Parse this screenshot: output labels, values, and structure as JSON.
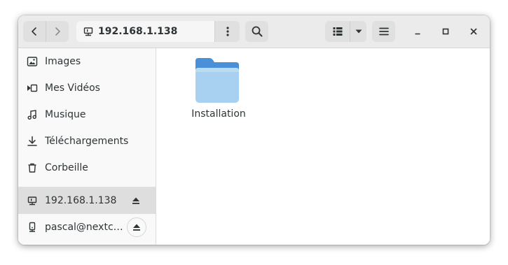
{
  "headerbar": {
    "location": "192.168.1.138"
  },
  "sidebar": {
    "places": [
      {
        "label": "Images",
        "icon": "image-icon"
      },
      {
        "label": "Mes Vidéos",
        "icon": "video-icon"
      },
      {
        "label": "Musique",
        "icon": "music-icon"
      },
      {
        "label": "Téléchargements",
        "icon": "download-icon"
      },
      {
        "label": "Corbeille",
        "icon": "trash-icon"
      }
    ],
    "network": [
      {
        "label": "192.168.1.138",
        "icon": "network-server-icon",
        "active": true
      },
      {
        "label": "pascal@nextcl…",
        "icon": "network-drive-icon",
        "active": false
      }
    ]
  },
  "content": {
    "items": [
      {
        "name": "Installation",
        "type": "folder-icon"
      }
    ]
  },
  "colors": {
    "folder_back": "#4a90d9",
    "folder_front": "#a8d0f0",
    "headerbar": "#ebebeb",
    "sidebar": "#f9f9f9",
    "selected": "#dedede"
  }
}
